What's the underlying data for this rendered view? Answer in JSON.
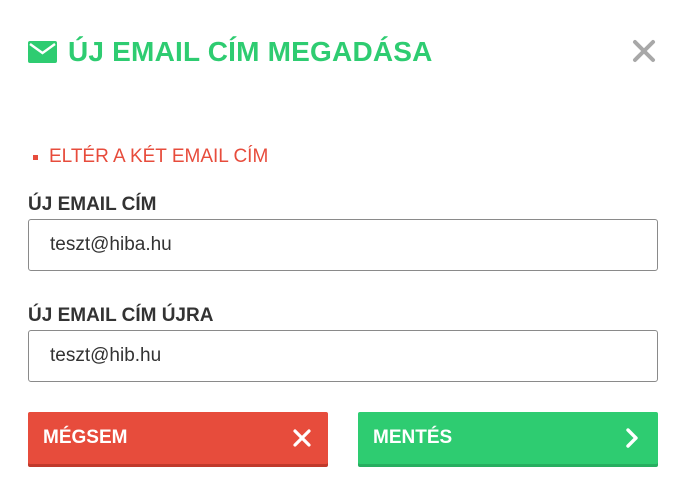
{
  "dialog": {
    "title": "ÚJ EMAIL CÍM MEGADÁSA",
    "title_icon": "envelope-icon",
    "close_icon": "close-icon"
  },
  "errors": [
    "ELTÉR A KÉT EMAIL CÍM"
  ],
  "form": {
    "email": {
      "label": "ÚJ EMAIL CÍM",
      "value": "teszt@hiba.hu"
    },
    "email_confirm": {
      "label": "ÚJ EMAIL CÍM ÚJRA",
      "value": "teszt@hib.hu"
    }
  },
  "buttons": {
    "cancel": {
      "label": "MÉGSEM",
      "icon": "close-icon"
    },
    "save": {
      "label": "MENTÉS",
      "icon": "chevron-right-icon"
    }
  },
  "colors": {
    "accent": "#2ecc71",
    "danger": "#e74c3c",
    "close": "#a8a8a8"
  }
}
